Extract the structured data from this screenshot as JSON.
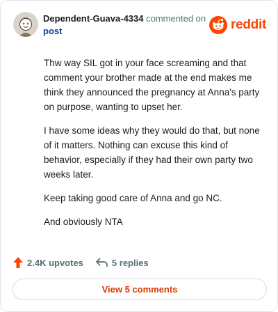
{
  "comment": {
    "username": "Dependent-Guava-4334",
    "commented_on": "commented on",
    "post_link": "post",
    "paragraphs": [
      "Thw way SIL got in your face screaming and that comment your brother made at the end makes me think they announced the pregnancy at Anna's party on purpose, wanting to upset her.",
      "I have some ideas why they would do that, but none of it matters. Nothing can excuse this kind of behavior, especially if they had their own party two weeks later.",
      "Keep taking good care of Anna and go NC.",
      "And obviously NTA"
    ]
  },
  "brand": {
    "name": "reddit",
    "color": "#ff4500"
  },
  "actions": {
    "upvotes": "2.4K upvotes",
    "replies": "5 replies"
  },
  "view_comments": "View 5 comments",
  "icons": [
    "avatar",
    "reddit-logo-icon",
    "upvote-arrow-icon",
    "reply-arrow-icon"
  ]
}
